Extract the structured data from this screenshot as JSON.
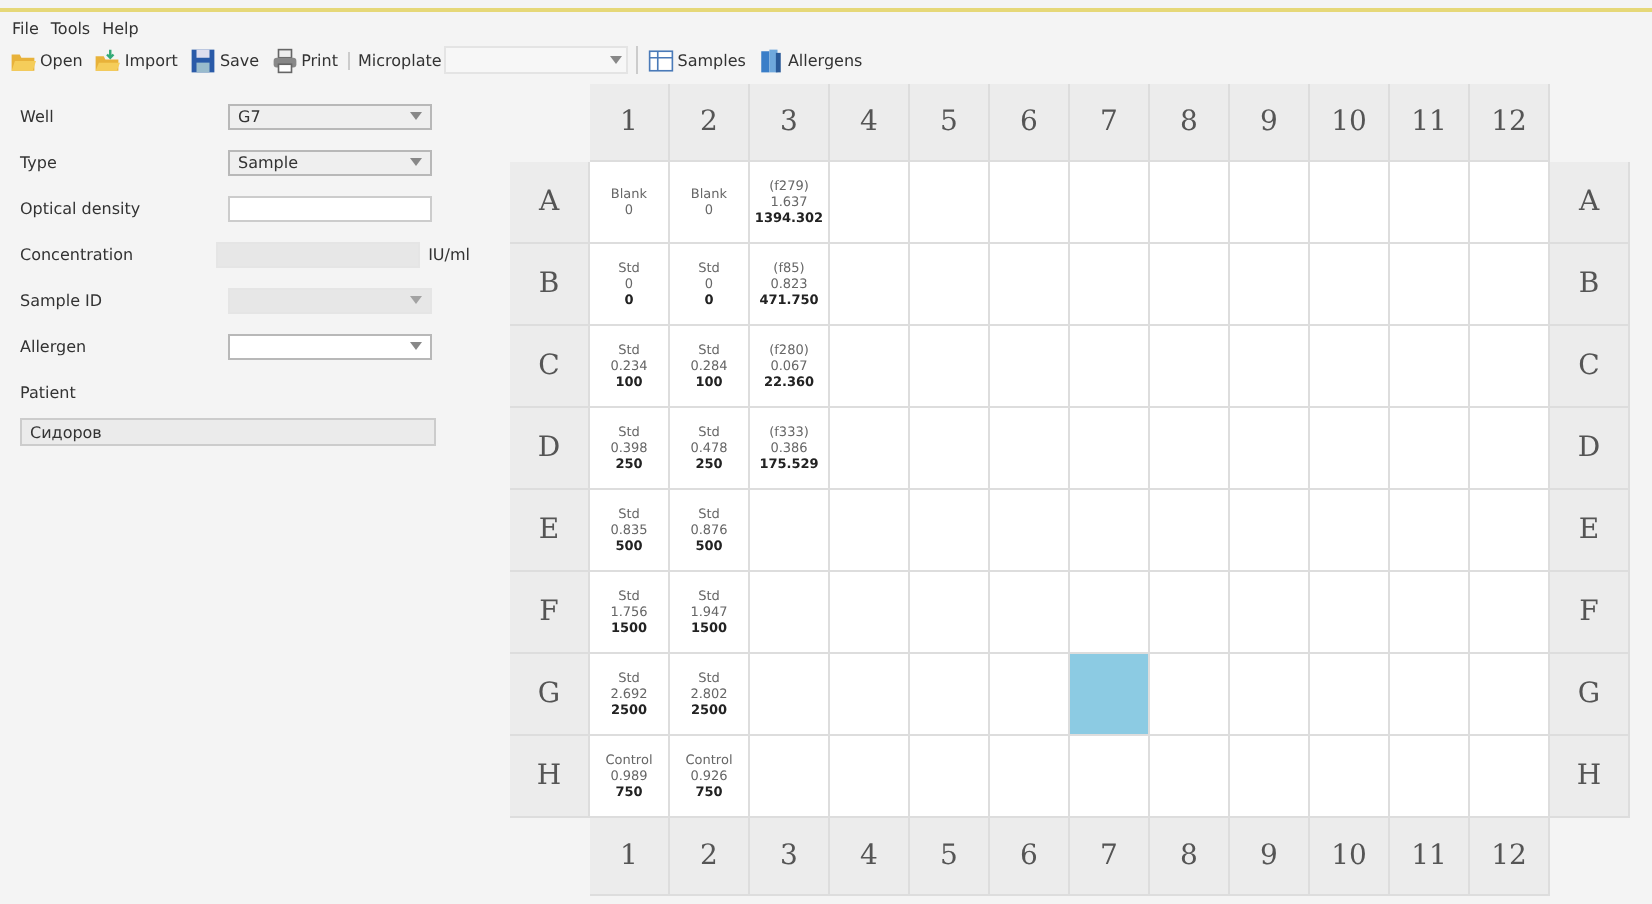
{
  "menu": [
    "File",
    "Tools",
    "Help"
  ],
  "toolbar": {
    "buttons": [
      {
        "label": "Open",
        "kind": "open"
      },
      {
        "label": "Import",
        "kind": "import"
      },
      {
        "label": "Save",
        "kind": "save"
      },
      {
        "label": "Print",
        "kind": "print"
      }
    ],
    "plate_label": "Microplate",
    "views": [
      {
        "label": "Samples",
        "kind": "samples"
      },
      {
        "label": "Allergens",
        "kind": "allergens"
      }
    ]
  },
  "form": {
    "fields": [
      {
        "label": "Well",
        "kind": "combo",
        "value": "G7",
        "disabled": false
      },
      {
        "label": "Type",
        "kind": "combo",
        "value": "Sample",
        "disabled": false
      },
      {
        "label": "Optical density",
        "kind": "input",
        "disabled": false
      },
      {
        "label": "Concentration",
        "kind": "input",
        "disabled": true,
        "unit": "IU/ml"
      },
      {
        "label": "Sample ID",
        "kind": "combo",
        "disabled": true
      },
      {
        "label": "Allergen",
        "kind": "combo",
        "disabled": false
      }
    ],
    "patient_label": "Patient",
    "patient": "Сидоров"
  },
  "plate": {
    "top_columns": [
      "1",
      "2",
      "3",
      "4",
      "5",
      "6",
      "7",
      "8",
      "9",
      "10",
      "11",
      "12"
    ],
    "rows": [
      {
        "left": "A",
        "right": "A",
        "cells": [
          {
            "type": "Blank",
            "od": "0",
            "selected": false
          },
          {
            "type": "Blank",
            "od": "0",
            "selected": false
          },
          {
            "type": "(f279)",
            "od": "1.637",
            "conc": "1394.302",
            "selected": false
          },
          {
            "selected": false
          },
          {
            "selected": false
          },
          {
            "selected": false
          },
          {
            "selected": false
          },
          {
            "selected": false
          },
          {
            "selected": false
          },
          {
            "selected": false
          },
          {
            "selected": false
          },
          {
            "selected": false
          }
        ]
      },
      {
        "left": "B",
        "right": "B",
        "cells": [
          {
            "type": "Std",
            "od": "0",
            "conc": "0",
            "selected": false
          },
          {
            "type": "Std",
            "od": "0",
            "conc": "0",
            "selected": false
          },
          {
            "type": "(f85)",
            "od": "0.823",
            "conc": "471.750",
            "selected": false
          },
          {
            "selected": false
          },
          {
            "selected": false
          },
          {
            "selected": false
          },
          {
            "selected": false
          },
          {
            "selected": false
          },
          {
            "selected": false
          },
          {
            "selected": false
          },
          {
            "selected": false
          },
          {
            "selected": false
          }
        ]
      },
      {
        "left": "C",
        "right": "C",
        "cells": [
          {
            "type": "Std",
            "od": "0.234",
            "conc": "100",
            "selected": false
          },
          {
            "type": "Std",
            "od": "0.284",
            "conc": "100",
            "selected": false
          },
          {
            "type": "(f280)",
            "od": "0.067",
            "conc": "22.360",
            "selected": false
          },
          {
            "selected": false
          },
          {
            "selected": false
          },
          {
            "selected": false
          },
          {
            "selected": false
          },
          {
            "selected": false
          },
          {
            "selected": false
          },
          {
            "selected": false
          },
          {
            "selected": false
          },
          {
            "selected": false
          }
        ]
      },
      {
        "left": "D",
        "right": "D",
        "cells": [
          {
            "type": "Std",
            "od": "0.398",
            "conc": "250",
            "selected": false
          },
          {
            "type": "Std",
            "od": "0.478",
            "conc": "250",
            "selected": false
          },
          {
            "type": "(f333)",
            "od": "0.386",
            "conc": "175.529",
            "selected": false
          },
          {
            "selected": false
          },
          {
            "selected": false
          },
          {
            "selected": false
          },
          {
            "selected": false
          },
          {
            "selected": false
          },
          {
            "selected": false
          },
          {
            "selected": false
          },
          {
            "selected": false
          },
          {
            "selected": false
          }
        ]
      },
      {
        "left": "E",
        "right": "E",
        "cells": [
          {
            "type": "Std",
            "od": "0.835",
            "conc": "500",
            "selected": false
          },
          {
            "type": "Std",
            "od": "0.876",
            "conc": "500",
            "selected": false
          },
          {
            "selected": false
          },
          {
            "selected": false
          },
          {
            "selected": false
          },
          {
            "selected": false
          },
          {
            "selected": false
          },
          {
            "selected": false
          },
          {
            "selected": false
          },
          {
            "selected": false
          },
          {
            "selected": false
          },
          {
            "selected": false
          }
        ]
      },
      {
        "left": "F",
        "right": "F",
        "cells": [
          {
            "type": "Std",
            "od": "1.756",
            "conc": "1500",
            "selected": false
          },
          {
            "type": "Std",
            "od": "1.947",
            "conc": "1500",
            "selected": false
          },
          {
            "selected": false
          },
          {
            "selected": false
          },
          {
            "selected": false
          },
          {
            "selected": false
          },
          {
            "selected": false
          },
          {
            "selected": false
          },
          {
            "selected": false
          },
          {
            "selected": false
          },
          {
            "selected": false
          },
          {
            "selected": false
          }
        ]
      },
      {
        "left": "G",
        "right": "G",
        "cells": [
          {
            "type": "Std",
            "od": "2.692",
            "conc": "2500",
            "selected": false
          },
          {
            "type": "Std",
            "od": "2.802",
            "conc": "2500",
            "selected": false
          },
          {
            "selected": false
          },
          {
            "selected": false
          },
          {
            "selected": false
          },
          {
            "selected": false
          },
          {
            "selected": true
          },
          {
            "selected": false
          },
          {
            "selected": false
          },
          {
            "selected": false
          },
          {
            "selected": false
          },
          {
            "selected": false
          }
        ]
      },
      {
        "left": "H",
        "right": "H",
        "cells": [
          {
            "type": "Control",
            "od": "0.989",
            "conc": "750",
            "selected": false
          },
          {
            "type": "Control",
            "od": "0.926",
            "conc": "750",
            "selected": false
          },
          {
            "selected": false
          },
          {
            "selected": false
          },
          {
            "selected": false
          },
          {
            "selected": false
          },
          {
            "selected": false
          },
          {
            "selected": false
          },
          {
            "selected": false
          },
          {
            "selected": false
          },
          {
            "selected": false
          },
          {
            "selected": false
          }
        ]
      }
    ],
    "bottom_columns": [
      "1",
      "2",
      "3",
      "4",
      "5",
      "6",
      "7",
      "8",
      "9",
      "10",
      "11",
      "12"
    ]
  }
}
